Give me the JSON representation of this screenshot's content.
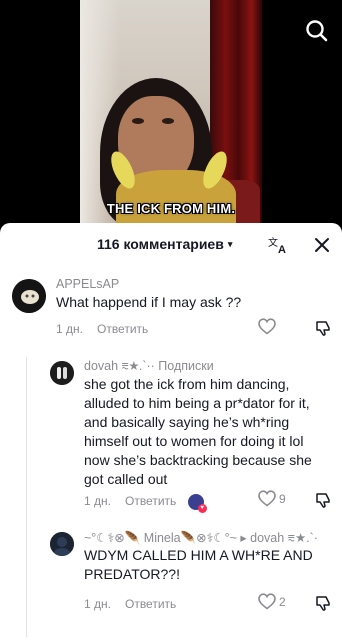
{
  "video": {
    "caption": "THE ICK FROM HIM."
  },
  "comments_panel": {
    "count_label": "116 комментариев",
    "chevron": "⌄"
  },
  "comments": [
    {
      "username": "APPELsAP",
      "text": "What happend if I may ask ??",
      "age": "1 дн.",
      "reply_label": "Ответить",
      "like_count": ""
    },
    {
      "username": "dovah ⩳★.`·· Подписки",
      "text": "she got the ick from him dancing, alluded to him being a pr*dator for it, and basically saying he’s wh*ring himself out to women for doing it lol now she’s backtracking because she got called out",
      "age": "1 дн.",
      "reply_label": "Ответить",
      "like_count": "9"
    },
    {
      "username": "~°☾⚕⊗🪶 Minela🪶⊗⚕☾°~ ▸ dovah ⩳★.`·",
      "text": "WDYM CALLED HIM A WH*RE AND PREDATOR??!",
      "age": "1 дн.",
      "reply_label": "Ответить",
      "like_count": "2"
    }
  ],
  "colors": {
    "text_primary": "#161823",
    "text_secondary": "#8a8b91",
    "accent_like": "#fe2c55"
  },
  "icons": [
    "search-icon",
    "translate-icon",
    "close-icon",
    "heart-icon",
    "dislike-icon"
  ]
}
